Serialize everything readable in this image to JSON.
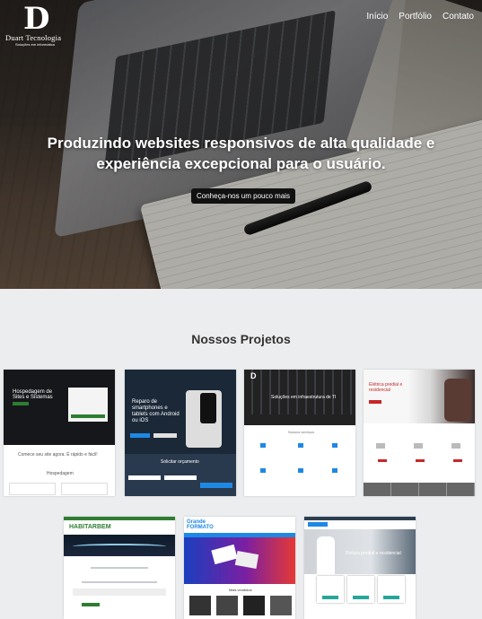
{
  "brand": {
    "mark": "D",
    "name": "Duart Tecnologia",
    "tagline": "Soluções em informática"
  },
  "nav": {
    "items": [
      "Início",
      "Portfólio",
      "Contato"
    ]
  },
  "hero": {
    "title": "Produzindo websites responsivos de alta qualidade e experiência excepcional para o usuário.",
    "button": "Conheça-nos um pouco mais"
  },
  "projects": {
    "title": "Nossos Projetos",
    "items": [
      {
        "heading": "Hospedagem de Sites e Sistemas",
        "caption": "Comece seu site agora. É rápido e fácil!",
        "sub": "Hospedagem"
      },
      {
        "heading": "Reparo de smartphones e tablets com Android ou iOS",
        "caption": "Solicitar orçamento"
      },
      {
        "heading": "Soluções em infraestrutura de TI",
        "caption": "Nossos serviços"
      },
      {
        "heading": "Elétrica predial e residencial"
      },
      {
        "heading": "HABITARBEM"
      },
      {
        "heading": "Grande FORMATO",
        "caption": "Mais vendidos"
      },
      {
        "heading": "Pintura predial e residencial"
      }
    ]
  },
  "colors": {
    "dark": "#1b1d21",
    "green": "#2e7d32",
    "blue": "#1e88e5",
    "red": "#c62828",
    "navy": "#2c3e50"
  }
}
